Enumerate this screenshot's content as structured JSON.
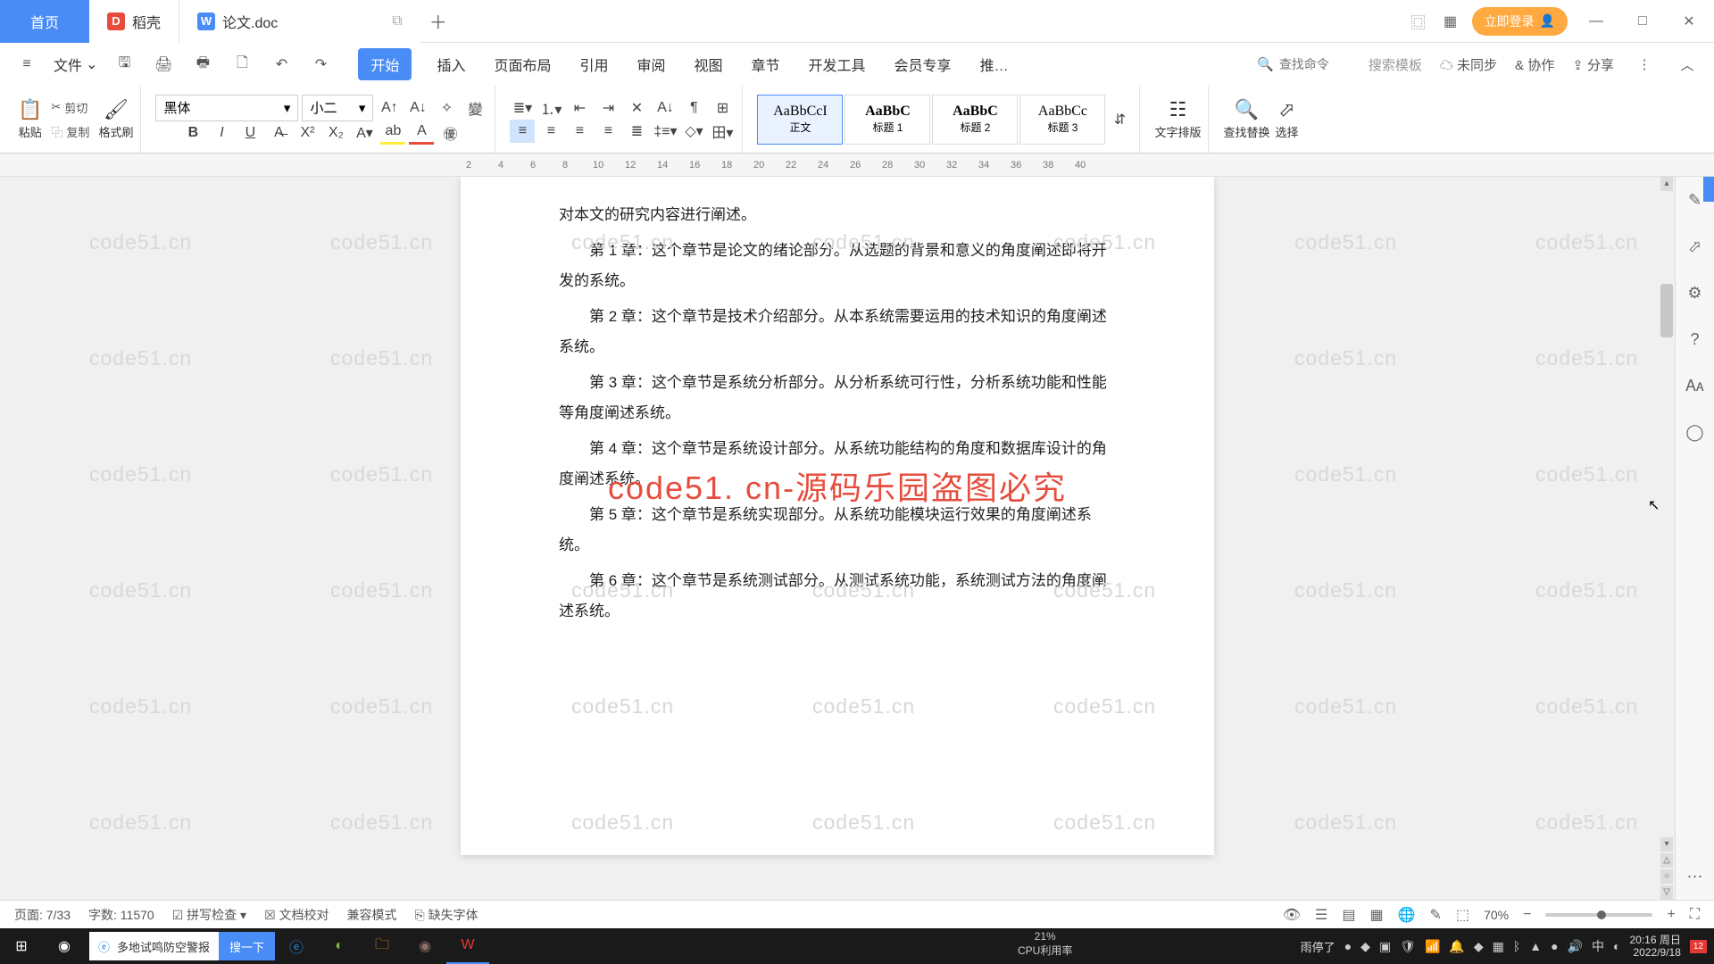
{
  "titlebar": {
    "home_label": "首页",
    "tab1_label": "稻壳",
    "tab2_label": "论文.doc",
    "login_label": "立即登录"
  },
  "menubar": {
    "file_label": "文件",
    "tabs": [
      "开始",
      "插入",
      "页面布局",
      "引用",
      "审阅",
      "视图",
      "章节",
      "开发工具",
      "会员专享",
      "推…"
    ],
    "search_placeholder": "查找命令",
    "template_placeholder": "搜索模板",
    "unsync_label": "未同步",
    "collab_label": "协作",
    "share_label": "分享"
  },
  "ribbon": {
    "paste_label": "粘贴",
    "cut_label": "剪切",
    "copy_label": "复制",
    "format_painter_label": "格式刷",
    "font_name": "黑体",
    "font_size": "小二",
    "styles": [
      {
        "preview": "AaBbCcI",
        "name": "正文"
      },
      {
        "preview": "AaBbC",
        "name": "标题 1"
      },
      {
        "preview": "AaBbC",
        "name": "标题 2"
      },
      {
        "preview": "AaBbCc",
        "name": "标题 3"
      }
    ],
    "text_layout_label": "文字排版",
    "find_replace_label": "查找替换",
    "select_label": "选择"
  },
  "ruler": [
    "2",
    "4",
    "6",
    "8",
    "10",
    "12",
    "14",
    "16",
    "18",
    "20",
    "22",
    "24",
    "26",
    "28",
    "30",
    "32",
    "34",
    "36",
    "38",
    "40"
  ],
  "document": {
    "lines": [
      "对本文的研究内容进行阐述。",
      "第 1 章：这个章节是论文的绪论部分。从选题的背景和意义的角度阐述即将开发的系统。",
      "第 2 章：这个章节是技术介绍部分。从本系统需要运用的技术知识的角度阐述系统。",
      "第 3 章：这个章节是系统分析部分。从分析系统可行性，分析系统功能和性能等角度阐述系统。",
      "第 4 章：这个章节是系统设计部分。从系统功能结构的角度和数据库设计的角度阐述系统。",
      "第 5 章：这个章节是系统实现部分。从系统功能模块运行效果的角度阐述系统。",
      "第 6 章：这个章节是系统测试部分。从测试系统功能，系统测试方法的角度阐述系统。"
    ]
  },
  "watermark_center": "code51. cn-源码乐园盗图必究",
  "watermark_bg": "code51.cn",
  "statusbar": {
    "page_label": "页面: 7/33",
    "word_count_label": "字数: 11570",
    "spell_check_label": "拼写检查",
    "doc_proof_label": "文档校对",
    "compat_label": "兼容模式",
    "missing_font_label": "缺失字体",
    "zoom_label": "70%"
  },
  "taskbar": {
    "search_text": "多地试鸣防空警报",
    "search_btn": "搜一下",
    "cpu_pct": "21%",
    "cpu_label": "CPU利用率",
    "gpu_label": "雨停了",
    "time": "20:16",
    "day": "周日",
    "date": "2022/9/18"
  }
}
